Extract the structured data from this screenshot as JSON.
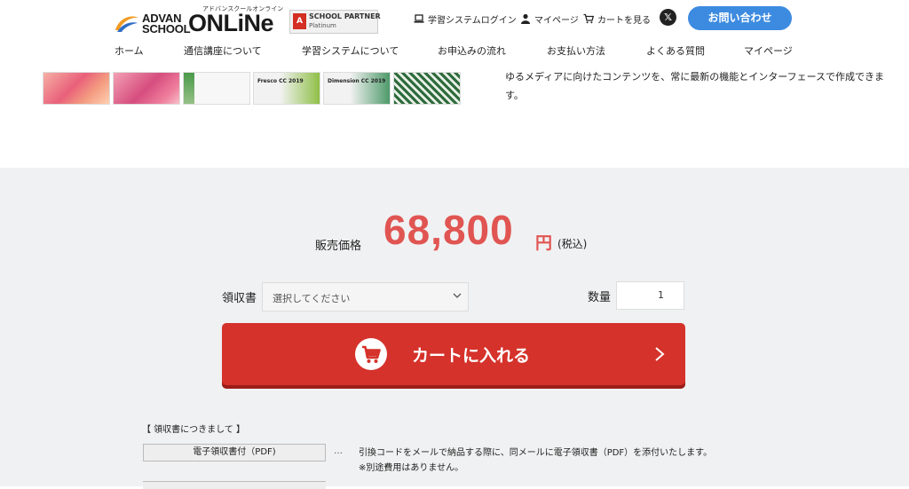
{
  "header": {
    "logo_advan": "ADVAN\nSCHOOL",
    "logo_online": "ONLiNe",
    "logo_kana": "アドバンスクールオンライン",
    "partner_title": "SCHOOL PARTNER",
    "partner_level": "Platinum",
    "partner_mark": "A",
    "links": [
      {
        "label": "学習システムログイン",
        "icon": "laptop-icon"
      },
      {
        "label": "マイページ",
        "icon": "user-icon"
      },
      {
        "label": "カートを見る",
        "icon": "cart-icon"
      }
    ],
    "x_label": "𝕏",
    "contact_label": "お問い合わせ"
  },
  "nav": [
    "ホーム",
    "通信講座について",
    "学習システムについて",
    "お申込みの流れ",
    "お支払い方法",
    "よくある質問",
    "マイページ"
  ],
  "thumbs": [
    {
      "title": ""
    },
    {
      "title": ""
    },
    {
      "title": ""
    },
    {
      "title": "Fresco CC 2019"
    },
    {
      "title": "Dimension CC 2019"
    },
    {
      "title": ""
    }
  ],
  "description": "ゆるメディアに向けたコンテンツを、常に最新の機能とインターフェースで作成できます。",
  "purchase": {
    "price_label": "販売価格",
    "price": "68,800",
    "currency": "円",
    "tax": "(税込)",
    "receipt_label": "領収書",
    "receipt_placeholder": "選択してください",
    "qty_label": "数量",
    "qty_value": "1",
    "cart_button": "カートに入れる"
  },
  "receipt_notes": {
    "title": "【 領収書につきまして 】",
    "option": "電子領収書付（PDF)",
    "dots": "…",
    "text_line1": "引換コードをメールで納品する際に、同メールに電子領収書（PDF）を添付いたします。",
    "text_line2": "※別途費用はありません。"
  },
  "colors": {
    "accent_red": "#d5322b",
    "price_red": "#e05552",
    "contact_blue": "#3c8be0"
  }
}
